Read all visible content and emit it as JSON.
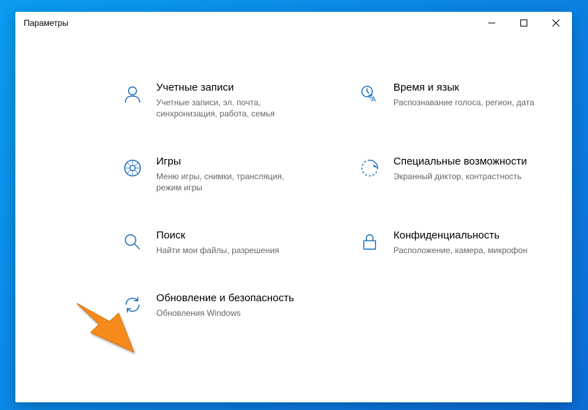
{
  "window": {
    "title": "Параметры"
  },
  "tiles": [
    {
      "title": "Учетные записи",
      "desc": "Учетные записи, эл. почта, синхронизация, работа, семья"
    },
    {
      "title": "Время и язык",
      "desc": "Распознавание голоса, регион, дата"
    },
    {
      "title": "Игры",
      "desc": "Меню игры, снимки, трансляция, режим игры"
    },
    {
      "title": "Специальные возможности",
      "desc": "Экранный диктор, контрастность"
    },
    {
      "title": "Поиск",
      "desc": "Найти мои файлы, разрешения"
    },
    {
      "title": "Конфиденциальность",
      "desc": "Расположение, камера, микрофон"
    },
    {
      "title": "Обновление и безопасность",
      "desc": "Обновления Windows"
    }
  ],
  "colors": {
    "accent": "#005fb8",
    "arrow": "#f68b1f"
  }
}
